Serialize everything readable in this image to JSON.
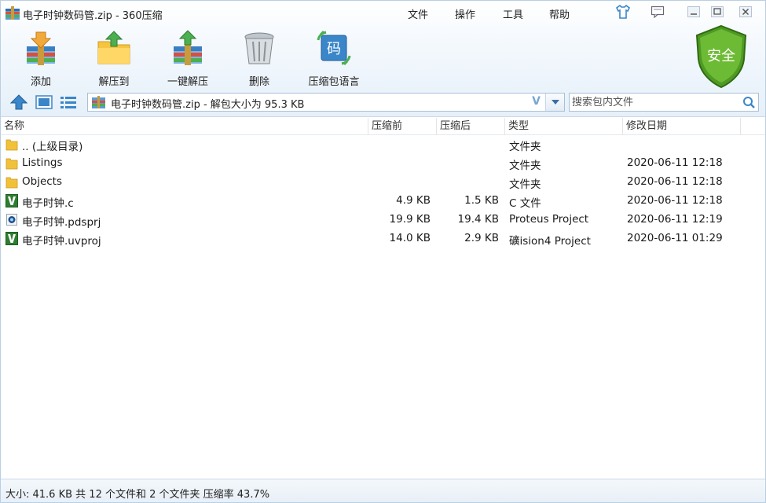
{
  "window": {
    "title": "电子时钟数码管.zip - 360压缩"
  },
  "menu": {
    "items": [
      "文件",
      "操作",
      "工具",
      "帮助"
    ]
  },
  "toolbar": {
    "items": [
      {
        "label": "添加",
        "icon": "add-to-archive-icon"
      },
      {
        "label": "解压到",
        "icon": "extract-to-folder-icon"
      },
      {
        "label": "一键解压",
        "icon": "one-click-extract-icon"
      },
      {
        "label": "删除",
        "icon": "delete-trash-icon"
      },
      {
        "label": "压缩包语言",
        "icon": "archive-language-icon"
      }
    ],
    "security_badge": "安全"
  },
  "address": {
    "path": "电子时钟数码管.zip - 解包大小为 95.3 KB",
    "dropdown_glyph": "V"
  },
  "search": {
    "placeholder": "搜索包内文件"
  },
  "columns": {
    "name": "名称",
    "compressed_before": "压缩前",
    "compressed_after": "压缩后",
    "type": "类型",
    "modified": "修改日期"
  },
  "files": [
    {
      "name": ".. (上级目录)",
      "before": "",
      "after": "",
      "type": "文件夹",
      "modified": "",
      "icon": "folder-icon"
    },
    {
      "name": "Listings",
      "before": "",
      "after": "",
      "type": "文件夹",
      "modified": "2020-06-11 12:18",
      "icon": "folder-icon"
    },
    {
      "name": "Objects",
      "before": "",
      "after": "",
      "type": "文件夹",
      "modified": "2020-06-11 12:18",
      "icon": "folder-icon"
    },
    {
      "name": "电子时钟.c",
      "before": "4.9 KB",
      "after": "1.5 KB",
      "type": "C 文件",
      "modified": "2020-06-11 12:18",
      "icon": "keil-file-icon"
    },
    {
      "name": "电子时钟.pdsprj",
      "before": "19.9 KB",
      "after": "19.4 KB",
      "type": "Proteus Project",
      "modified": "2020-06-11 12:19",
      "icon": "proteus-file-icon"
    },
    {
      "name": "电子时钟.uvproj",
      "before": "14.0 KB",
      "after": "2.9 KB",
      "type": "礦ision4 Project",
      "modified": "2020-06-11 01:29",
      "icon": "keil-file-icon"
    }
  ],
  "status": {
    "text": "大小: 41.6 KB 共 12 个文件和 2 个文件夹 压缩率 43.7%"
  },
  "colors": {
    "accent_blue": "#3a86c8",
    "shield_green": "#5aa62a",
    "folder_yellow": "#f2c13a"
  }
}
